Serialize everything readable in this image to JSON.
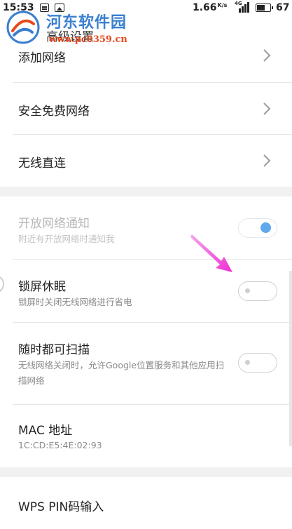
{
  "status_bar": {
    "time": "15:53",
    "net_speed": "1.66",
    "net_speed_unit": "K/s",
    "signal_label": "4G",
    "battery_level": 67,
    "battery": "67"
  },
  "header": {
    "title": "高级设置"
  },
  "watermark": {
    "name": "河东软件园",
    "url": "www.pc0359.cn"
  },
  "group1": {
    "items": [
      {
        "label": "添加网络"
      },
      {
        "label": "安全免费网络"
      },
      {
        "label": "无线直连"
      }
    ]
  },
  "group2": {
    "items": [
      {
        "label": "开放网络通知",
        "sub": "附近有开放网络时通知我",
        "switch_on": true,
        "enabled": false
      },
      {
        "label": "锁屏休眠",
        "sub": "锁屏时关闭无线网络进行省电",
        "switch_on": false,
        "enabled": true
      },
      {
        "label": "随时都可扫描",
        "sub": "无线网络关闭时，允许Google位置服务和其他应用扫描网络",
        "switch_on": false,
        "enabled": true
      },
      {
        "label": "MAC 地址",
        "sub": "1C:CD:E5:4E:02:93"
      }
    ]
  },
  "group3": {
    "items": [
      {
        "label": "WPS PIN码输入"
      }
    ]
  },
  "colors": {
    "accent": "#5fa8ec",
    "annotation_arrow": "#ee2fd3",
    "watermark_blue": "#3a7fcf",
    "watermark_orange": "#e8491d"
  }
}
